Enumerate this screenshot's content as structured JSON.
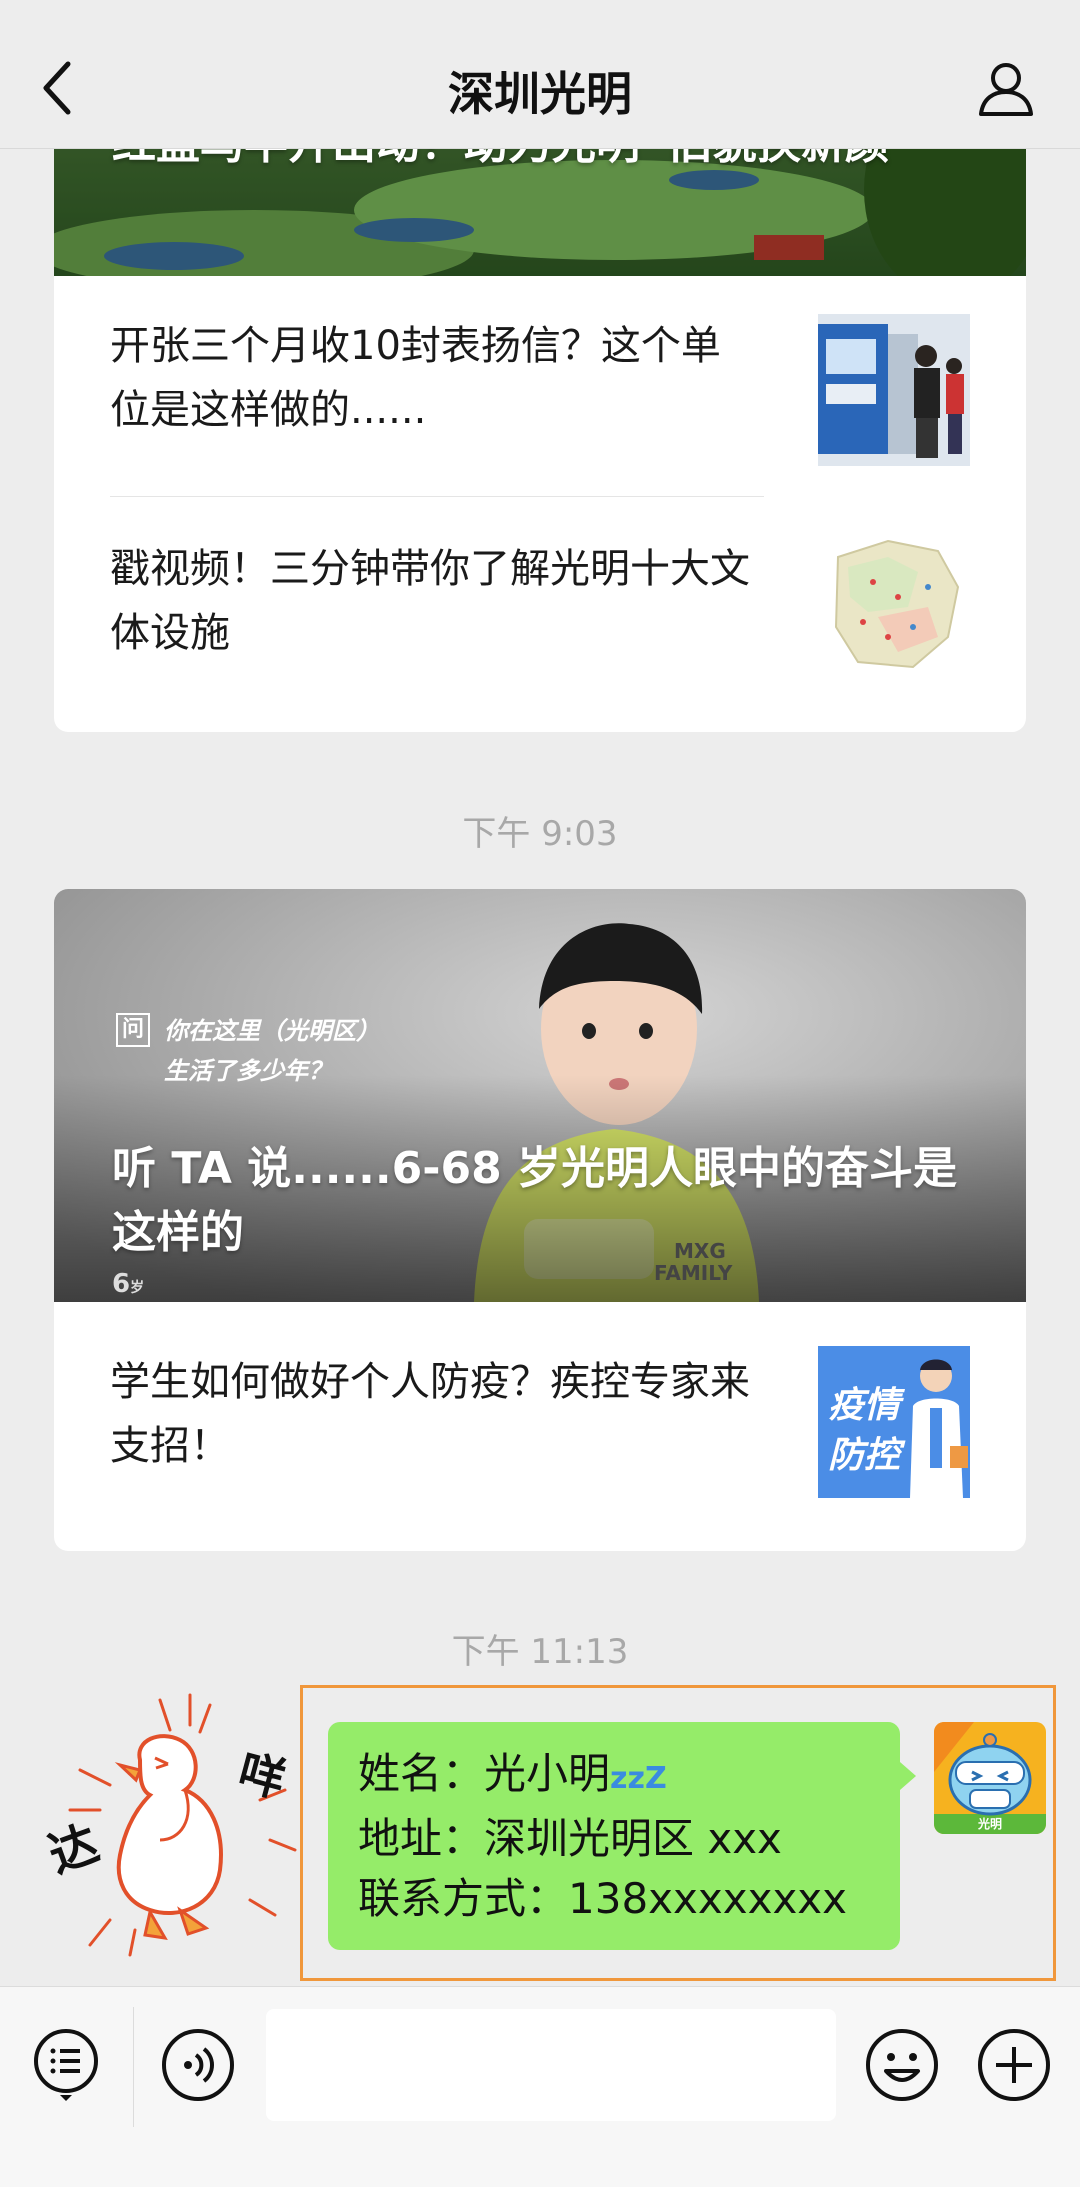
{
  "header": {
    "title": "深圳光明",
    "back_icon": "chevron-left-icon",
    "profile_icon": "person-icon"
  },
  "card1": {
    "hero_title": "红蓝鸟半开出动！助力光明“旧貌换新颜”",
    "items": [
      {
        "title": "开张三个月收10封表扬信？这个单位是这样做的......"
      },
      {
        "title": "戳视频！三分钟带你了解光明十大文体设施"
      }
    ]
  },
  "time1": "下午 9:03",
  "card2": {
    "hero_title": "听 TA 说......6-68 岁光明人眼中的奋斗是这样的",
    "hero_overlay_question": "你在这里（光明区）",
    "hero_overlay_question2": "生活了多少年？",
    "hero_overlay_q_mark": "问",
    "hero_age": "6",
    "hero_age_unit": "岁",
    "shirt_text1": "MXG",
    "shirt_text2": "FAMILY",
    "items": [
      {
        "title": "学生如何做好个人防疫？疾控专家来支招！",
        "thumb_text1": "疫情",
        "thumb_text2": "防控"
      }
    ]
  },
  "time2": "下午 11:13",
  "message": {
    "name_line": "姓名：光小明",
    "zz": "zzZ",
    "address_line": "地址：深圳光明区 xxx",
    "contact_line": "联系方式：138xxxxxxxx",
    "avatar_label": "光明"
  },
  "sticker": {
    "text_left": "达",
    "text_right": "咩"
  },
  "bottom": {
    "menu_icon": "list-menu-icon",
    "voice_icon": "voice-icon",
    "emoji_icon": "smile-icon",
    "plus_icon": "plus-icon",
    "input_value": ""
  },
  "colors": {
    "bubble": "#95ec69",
    "highlight": "#f0973b",
    "bg": "#ededed"
  }
}
